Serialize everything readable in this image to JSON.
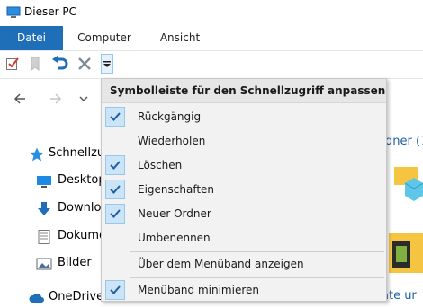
{
  "window": {
    "title": "Dieser PC"
  },
  "ribbon": {
    "tabs": [
      {
        "label": "Datei"
      },
      {
        "label": "Computer"
      },
      {
        "label": "Ansicht"
      }
    ]
  },
  "tree": {
    "items": [
      {
        "label": "Schnellzugriff",
        "icon": "star-icon"
      },
      {
        "label": "Desktop",
        "icon": "desktop-icon"
      },
      {
        "label": "Downloads",
        "icon": "download-icon"
      },
      {
        "label": "Dokumente",
        "icon": "document-icon"
      },
      {
        "label": "Bilder",
        "icon": "pictures-icon"
      },
      {
        "label": "OneDrive",
        "icon": "cloud-icon"
      }
    ]
  },
  "content": {
    "text_1": "dner (7",
    "text_2": "äte ur"
  },
  "qat_menu": {
    "header": "Symbolleiste für den Schnellzugriff anpassen",
    "items": [
      {
        "label": "Rückgängig",
        "checked": true
      },
      {
        "label": "Wiederholen",
        "checked": false
      },
      {
        "label": "Löschen",
        "checked": true
      },
      {
        "label": "Eigenschaften",
        "checked": true
      },
      {
        "label": "Neuer Ordner",
        "checked": true
      },
      {
        "label": "Umbenennen",
        "checked": false
      },
      {
        "label": "Über dem Menüband anzeigen",
        "checked": false
      },
      {
        "label": "Menüband minimieren",
        "checked": true
      }
    ]
  },
  "colors": {
    "accent": "#1e6eb8",
    "check": "#1e5fa6",
    "menu_bg": "#f2f2f2"
  }
}
